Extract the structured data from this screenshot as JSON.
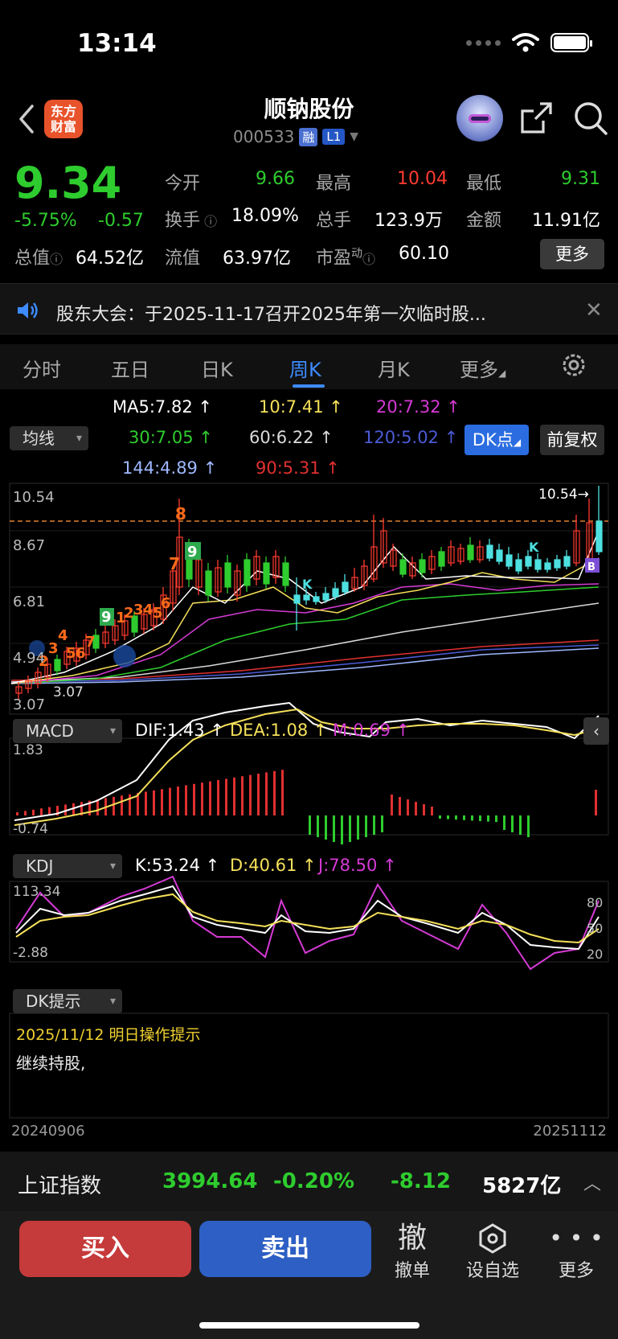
{
  "status": {
    "time": "13:14"
  },
  "header": {
    "logo_line1": "东方",
    "logo_line2": "财富",
    "stock_name": "顺钠股份",
    "stock_code": "000533",
    "tag_rong": "融",
    "tag_level": "L1"
  },
  "quote": {
    "price": "9.34",
    "change_pct": "-5.75%",
    "change": "-0.57",
    "stats": [
      {
        "label": "今开",
        "value": "9.66",
        "color": "#2ecc2e"
      },
      {
        "label": "最高",
        "value": "10.04",
        "color": "#ff3b30"
      },
      {
        "label": "最低",
        "value": "9.31",
        "color": "#2ecc2e"
      },
      {
        "label": "换手",
        "value": "18.09%",
        "color": "#ffffff"
      },
      {
        "label": "总手",
        "value": "123.9万",
        "color": "#ffffff"
      },
      {
        "label": "金额",
        "value": "11.91亿",
        "color": "#ffffff"
      },
      {
        "label": "总值",
        "value": "64.52亿",
        "color": "#ffffff"
      },
      {
        "label": "流值",
        "value": "63.97亿",
        "color": "#ffffff"
      },
      {
        "label": "市盈",
        "sup": "动",
        "value": "60.10",
        "color": "#ffffff"
      }
    ],
    "more_label": "更多"
  },
  "notice": {
    "text": "股东大会：于2025-11-17召开2025年第一次临时股..."
  },
  "tabs": [
    {
      "label": "分时",
      "active": false
    },
    {
      "label": "五日",
      "active": false
    },
    {
      "label": "日K",
      "active": false
    },
    {
      "label": "周K",
      "active": true
    },
    {
      "label": "月K",
      "active": false
    },
    {
      "label": "更多",
      "active": false
    }
  ],
  "ma": {
    "selector": "均线",
    "ma5": "MA5:7.82",
    "ma10": "10:7.41",
    "ma20": "20:7.32",
    "ma30": "30:7.05",
    "ma60": "60:6.22",
    "ma120": "120:5.02",
    "ma144": "144:4.89",
    "ma90": "90:5.31",
    "dk_button": "DK点",
    "fq_button": "前复权"
  },
  "kline": {
    "price_labels": [
      "10.54",
      "8.67",
      "6.81",
      "4.94",
      "3.07"
    ],
    "max_marker": "10.54→",
    "min_marker": "3.07",
    "marker_8": "8",
    "marker_7": "7",
    "marker_9a": "9",
    "marker_9b": "9",
    "early_markers": [
      "2",
      "3",
      "4",
      "5",
      "6",
      "7",
      "1",
      "2",
      "3",
      "4",
      "5",
      "6"
    ],
    "k_marker": "K",
    "k_marker_b": "K",
    "b_marker": "B"
  },
  "macd": {
    "selector": "MACD",
    "dif": "DIF:1.43",
    "dea": "DEA:1.08",
    "m": "M:0.69",
    "top": "1.83",
    "bottom": "-0.74"
  },
  "kdj": {
    "selector": "KDJ",
    "k": "K:53.24",
    "d": "D:40.61",
    "j": "J:78.50",
    "top": "113.34",
    "bottom": "-2.88",
    "lvl80": "80",
    "lvl50": "50",
    "lvl20": "20"
  },
  "dk": {
    "selector": "DK提示",
    "date_line": "2025/11/12 明日操作提示",
    "text": "继续持股,"
  },
  "dates": {
    "start": "20240906",
    "end": "20251112"
  },
  "index_bar": {
    "name": "上证指数",
    "value": "3994.64",
    "pct": "-0.20%",
    "change": "-8.12",
    "volume": "5827亿"
  },
  "bottom_bar": {
    "buy": "买入",
    "sell": "卖出",
    "cancel_icon": "撤",
    "cancel": "撤单",
    "watch": "设自选",
    "more": "更多"
  },
  "colors": {
    "up": "#ff3b30",
    "down": "#2ecc2e",
    "accent": "#3d8bff",
    "ma5": "#ffffff",
    "ma10": "#f5e05a",
    "ma20": "#d53ad5",
    "ma30": "#2ecc2e",
    "ma60": "#d9d9d9",
    "ma120": "#4b5bd6",
    "ma144": "#9fb8ff",
    "ma90": "#e03030"
  }
}
